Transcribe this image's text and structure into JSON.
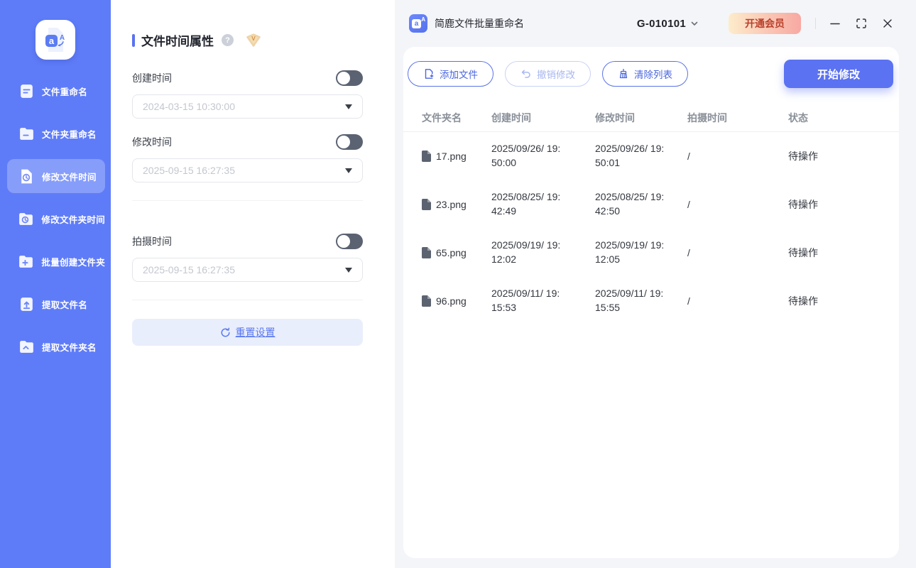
{
  "window": {
    "title": "简鹿文件批量重命名",
    "license_code": "G-010101",
    "membership_label": "开通会员"
  },
  "sidebar": {
    "items": [
      {
        "label": "文件重命名",
        "icon": "file-rename-icon",
        "active": false
      },
      {
        "label": "文件夹重命名",
        "icon": "folder-rename-icon",
        "active": false
      },
      {
        "label": "修改文件时间",
        "icon": "file-time-icon",
        "active": true
      },
      {
        "label": "修改文件夹时间",
        "icon": "folder-time-icon",
        "active": false
      },
      {
        "label": "批量创建文件夹",
        "icon": "folder-create-icon",
        "active": false
      },
      {
        "label": "提取文件名",
        "icon": "extract-filename-icon",
        "active": false
      },
      {
        "label": "提取文件夹名",
        "icon": "extract-foldername-icon",
        "active": false
      }
    ]
  },
  "settings": {
    "title": "文件时间属性",
    "create_time": {
      "label": "创建时间",
      "value": "2024-03-15 10:30:00",
      "enabled": false
    },
    "modify_time": {
      "label": "修改时间",
      "value": "2025-09-15 16:27:35",
      "enabled": false
    },
    "shoot_time": {
      "label": "拍摄时间",
      "value": "2025-09-15 16:27:35",
      "enabled": false
    },
    "reset_label": "重置设置"
  },
  "toolbar": {
    "add_files_label": "添加文件",
    "undo_label": "撤销修改",
    "clear_label": "清除列表",
    "start_label": "开始修改"
  },
  "table": {
    "headers": [
      "文件夹名",
      "创建时间",
      "修改时间",
      "拍摄时间",
      "状态"
    ],
    "rows": [
      {
        "name": "17.png",
        "created": "2025/09/26/ 19:50:00",
        "modified": "2025/09/26/ 19:50:01",
        "shot_time": "/",
        "status": "待操作"
      },
      {
        "name": "23.png",
        "created": "2025/08/25/ 19:42:49",
        "modified": "2025/08/25/ 19:42:50",
        "shot_time": "/",
        "status": "待操作"
      },
      {
        "name": "65.png",
        "created": "2025/09/19/ 19:12:02",
        "modified": "2025/09/19/ 19:12:05",
        "shot_time": "/",
        "status": "待操作"
      },
      {
        "name": "96.png",
        "created": "2025/09/11/ 19:15:53",
        "modified": "2025/09/11/ 19:15:55",
        "shot_time": "/",
        "status": "待操作"
      }
    ]
  },
  "colors": {
    "sidebar_bg": "#5f7cf8",
    "accent_blue": "#5b72f2",
    "panel_bg": "#f4f5f9",
    "toggle_off_track": "#5b6372",
    "membership_gradient_start": "#fdeccb",
    "membership_gradient_end": "#f8a8a2",
    "membership_text": "#b8402c"
  }
}
